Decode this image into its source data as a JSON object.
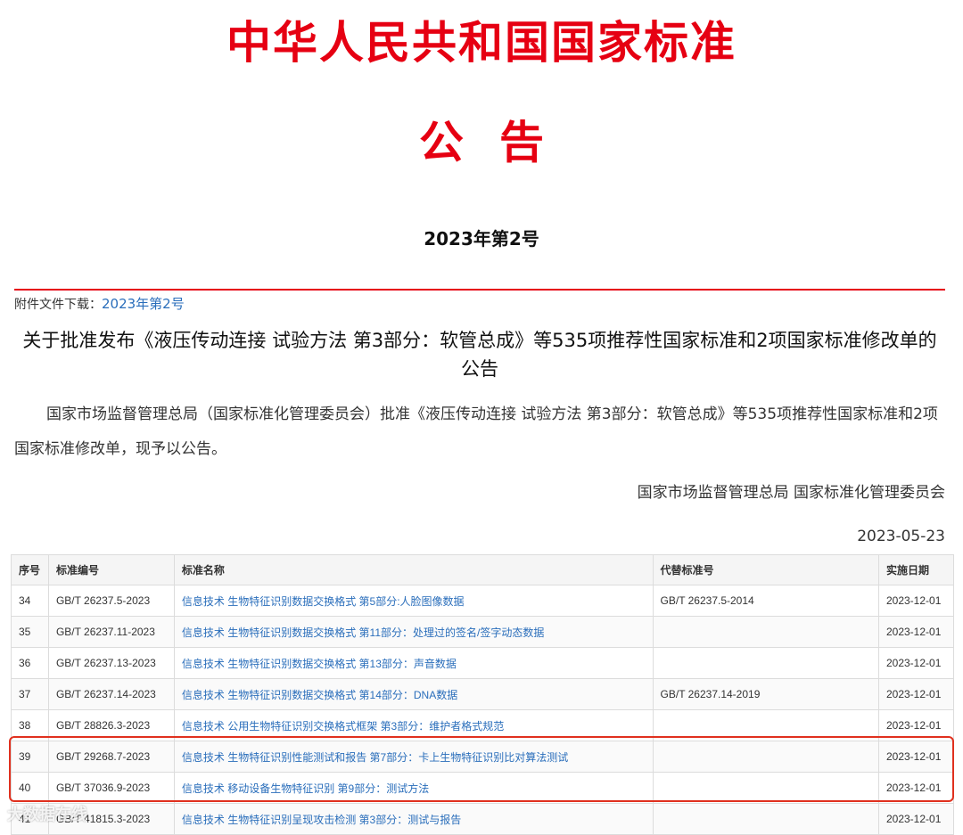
{
  "header": {
    "masthead": "中华人民共和国国家标准",
    "announcement": "公告",
    "doc_number": "2023年第2号"
  },
  "attachment": {
    "label": "附件文件下载：",
    "link_text": "2023年第2号"
  },
  "notice": {
    "title": "关于批准发布《液压传动连接 试验方法 第3部分：软管总成》等535项推荐性国家标准和2项国家标准修改单的公告",
    "body": "国家市场监督管理总局（国家标准化管理委员会）批准《液压传动连接 试验方法 第3部分：软管总成》等535项推荐性国家标准和2项国家标准修改单，现予以公告。",
    "issuer": "国家市场监督管理总局 国家标准化管理委员会",
    "date": "2023-05-23"
  },
  "table": {
    "headers": [
      "序号",
      "标准编号",
      "标准名称",
      "代替标准号",
      "实施日期"
    ],
    "rows": [
      {
        "no": "34",
        "code": "GB/T 26237.5-2023",
        "name": "信息技术 生物特征识别数据交换格式 第5部分:人脸图像数据",
        "replaces": "GB/T 26237.5-2014",
        "date": "2023-12-01"
      },
      {
        "no": "35",
        "code": "GB/T 26237.11-2023",
        "name": "信息技术 生物特征识别数据交换格式 第11部分：处理过的签名/签字动态数据",
        "replaces": "",
        "date": "2023-12-01"
      },
      {
        "no": "36",
        "code": "GB/T 26237.13-2023",
        "name": "信息技术 生物特征识别数据交换格式 第13部分：声音数据",
        "replaces": "",
        "date": "2023-12-01"
      },
      {
        "no": "37",
        "code": "GB/T 26237.14-2023",
        "name": "信息技术 生物特征识别数据交换格式 第14部分：DNA数据",
        "replaces": "GB/T 26237.14-2019",
        "date": "2023-12-01"
      },
      {
        "no": "38",
        "code": "GB/T 28826.3-2023",
        "name": "信息技术 公用生物特征识别交换格式框架 第3部分：维护者格式规范",
        "replaces": "",
        "date": "2023-12-01"
      },
      {
        "no": "39",
        "code": "GB/T 29268.7-2023",
        "name": "信息技术 生物特征识别性能测试和报告 第7部分：卡上生物特征识别比对算法测试",
        "replaces": "",
        "date": "2023-12-01"
      },
      {
        "no": "40",
        "code": "GB/T 37036.9-2023",
        "name": "信息技术 移动设备生物特征识别 第9部分：测试方法",
        "replaces": "",
        "date": "2023-12-01"
      },
      {
        "no": "41",
        "code": "GB/T 41815.3-2023",
        "name": "信息技术 生物特征识别呈现攻击检测 第3部分：测试与报告",
        "replaces": "",
        "date": "2023-12-01"
      }
    ]
  },
  "watermark": "大数据在线",
  "colors": {
    "masthead_red": "#e60012",
    "link_blue": "#2a6ebb",
    "highlight_red": "#e0301e"
  }
}
